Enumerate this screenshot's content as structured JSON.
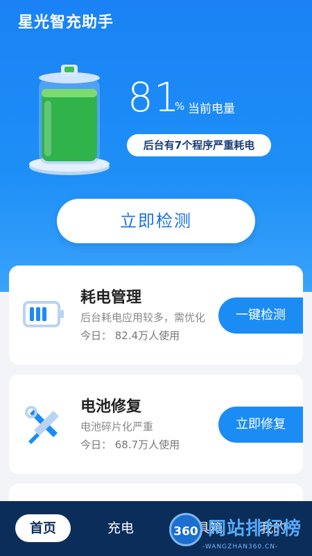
{
  "app": {
    "title": "星光智充助手"
  },
  "battery": {
    "percent_value": "81",
    "percent_unit": "%",
    "label": "当前电量",
    "level": 0.81,
    "background_notice": "后台有7个程序严重耗电"
  },
  "detect_button": {
    "label": "立即检测"
  },
  "cards": [
    {
      "title": "耗电管理",
      "desc": "后台耗电应用较多，需优化",
      "count": "今日： 82.4万人使用",
      "button": "一键检测",
      "icon": "battery-icon"
    },
    {
      "title": "电池修复",
      "desc": "电池碎片化严重",
      "count": "今日： 68.7万人使用",
      "button": "立即修复",
      "icon": "tools-icon"
    }
  ],
  "tabbar": {
    "tabs": [
      "首页",
      "充电",
      "工具箱",
      "我的"
    ]
  },
  "watermark": {
    "logo": "360",
    "text": "网站排行榜",
    "sub": "-WANGZHAN360.CN-"
  },
  "colors": {
    "primary": "#1c8cf5",
    "header_top": "#1a82f5",
    "tabbar_bg": "#0b2d5a",
    "battery_fill": "#2fb34a"
  }
}
